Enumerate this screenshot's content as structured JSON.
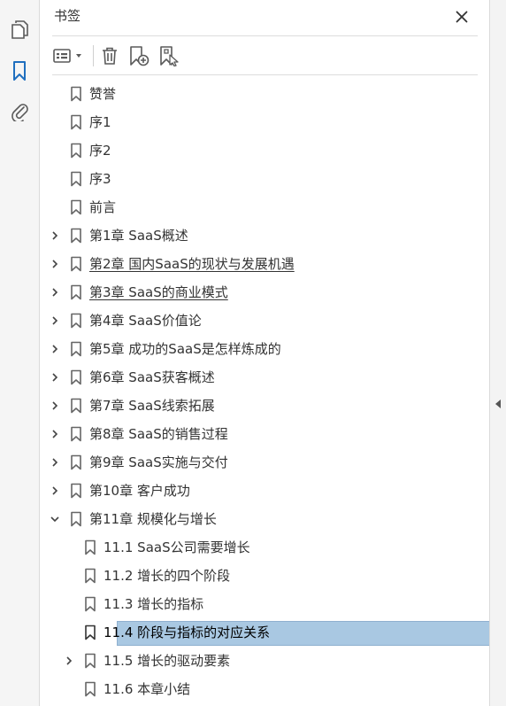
{
  "panel": {
    "title": "书签"
  },
  "colors": {
    "selection": "#a9c8e2",
    "accent": "#1f6fbf",
    "icon": "#5a5a5a"
  },
  "rail_icons": [
    "pages-icon",
    "bookmark-icon",
    "attachment-icon"
  ],
  "toolbar_icons": [
    "options-menu-icon",
    "delete-icon",
    "new-bookmark-icon",
    "bookmark-from-structure-icon"
  ],
  "bookmarks": [
    {
      "label": "赞誉",
      "level": 0,
      "expander": "none",
      "underlined": false,
      "selected": false
    },
    {
      "label": "序1",
      "level": 0,
      "expander": "none",
      "underlined": false,
      "selected": false
    },
    {
      "label": "序2",
      "level": 0,
      "expander": "none",
      "underlined": false,
      "selected": false
    },
    {
      "label": "序3",
      "level": 0,
      "expander": "none",
      "underlined": false,
      "selected": false
    },
    {
      "label": "前言",
      "level": 0,
      "expander": "none",
      "underlined": false,
      "selected": false
    },
    {
      "label": "第1章 SaaS概述",
      "level": 0,
      "expander": "collapsed",
      "underlined": false,
      "selected": false
    },
    {
      "label": "第2章 国内SaaS的现状与发展机遇",
      "level": 0,
      "expander": "collapsed",
      "underlined": true,
      "selected": false
    },
    {
      "label": "第3章 SaaS的商业模式",
      "level": 0,
      "expander": "collapsed",
      "underlined": true,
      "selected": false
    },
    {
      "label": "第4章 SaaS价值论",
      "level": 0,
      "expander": "collapsed",
      "underlined": false,
      "selected": false
    },
    {
      "label": "第5章 成功的SaaS是怎样炼成的",
      "level": 0,
      "expander": "collapsed",
      "underlined": false,
      "selected": false
    },
    {
      "label": "第6章 SaaS获客概述",
      "level": 0,
      "expander": "collapsed",
      "underlined": false,
      "selected": false
    },
    {
      "label": "第7章 SaaS线索拓展",
      "level": 0,
      "expander": "collapsed",
      "underlined": false,
      "selected": false
    },
    {
      "label": "第8章 SaaS的销售过程",
      "level": 0,
      "expander": "collapsed",
      "underlined": false,
      "selected": false
    },
    {
      "label": "第9章 SaaS实施与交付",
      "level": 0,
      "expander": "collapsed",
      "underlined": false,
      "selected": false
    },
    {
      "label": "第10章 客户成功",
      "level": 0,
      "expander": "collapsed",
      "underlined": false,
      "selected": false
    },
    {
      "label": "第11章 规模化与增长",
      "level": 0,
      "expander": "expanded",
      "underlined": false,
      "selected": false
    },
    {
      "label": "11.1 SaaS公司需要增长",
      "level": 1,
      "expander": "none",
      "underlined": false,
      "selected": false
    },
    {
      "label": "11.2 增长的四个阶段",
      "level": 1,
      "expander": "none",
      "underlined": false,
      "selected": false
    },
    {
      "label": "11.3 增长的指标",
      "level": 1,
      "expander": "none",
      "underlined": false,
      "selected": false
    },
    {
      "label": "11.4 阶段与指标的对应关系",
      "level": 1,
      "expander": "none",
      "underlined": false,
      "selected": true
    },
    {
      "label": "11.5 增长的驱动要素",
      "level": 1,
      "expander": "collapsed",
      "underlined": false,
      "selected": false
    },
    {
      "label": "11.6 本章小结",
      "level": 1,
      "expander": "none",
      "underlined": false,
      "selected": false
    }
  ]
}
